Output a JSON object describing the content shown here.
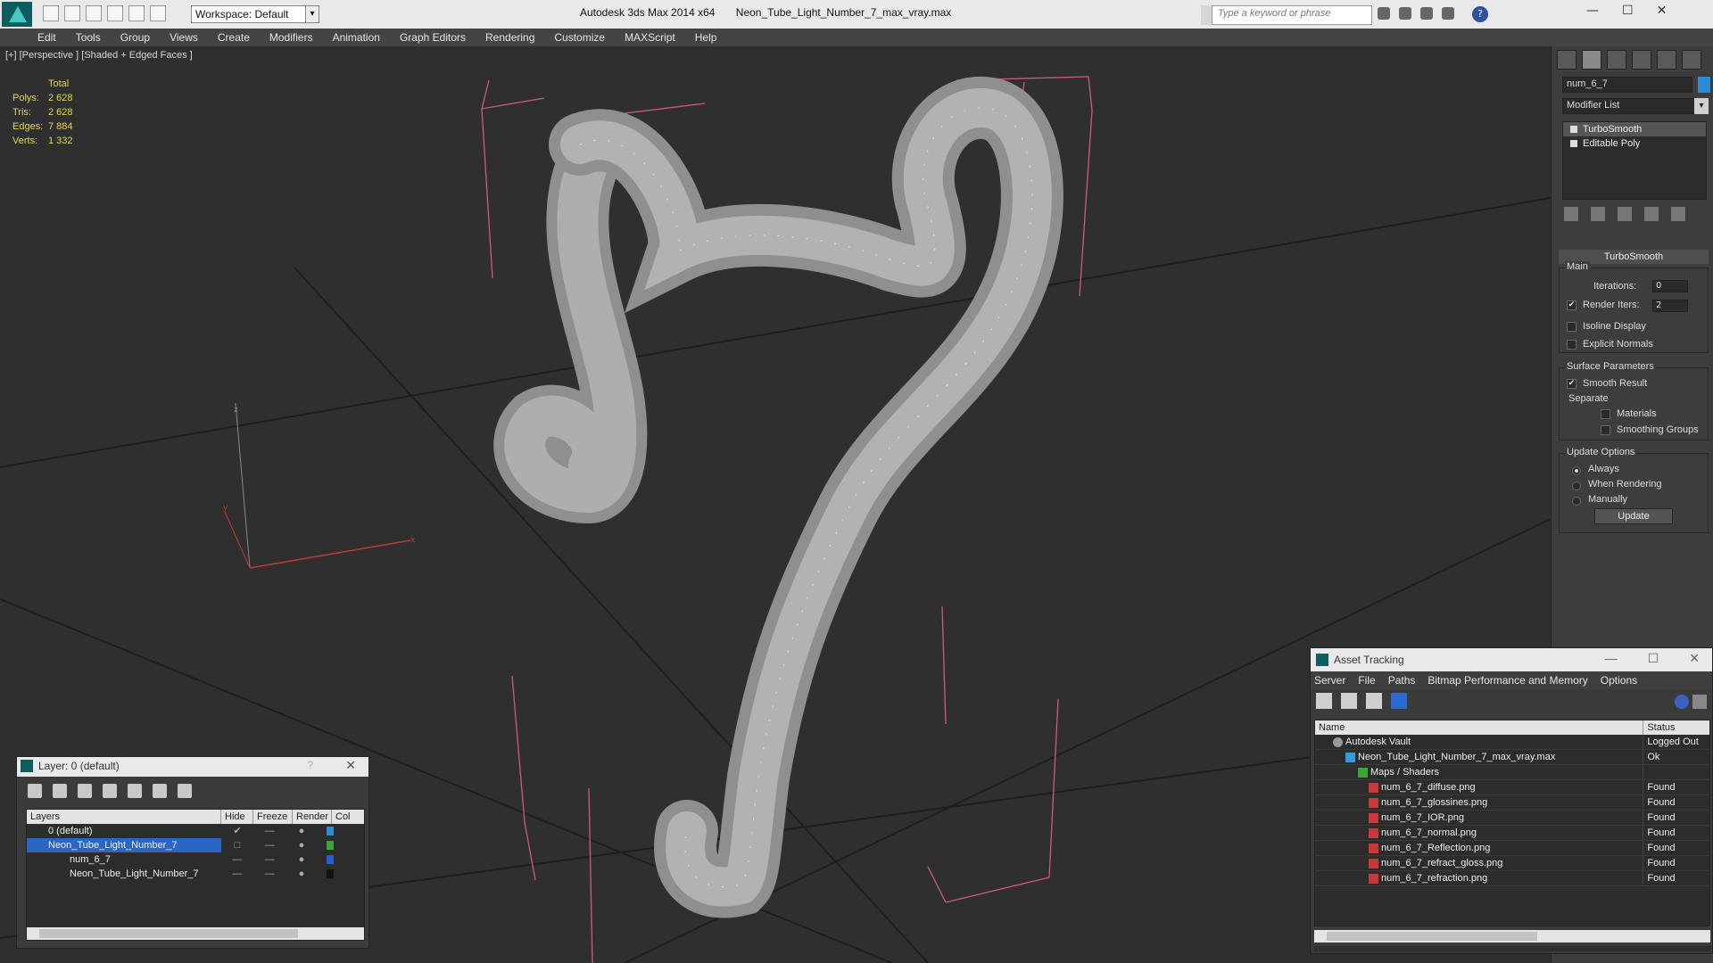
{
  "app": {
    "title": "Autodesk 3ds Max 2014 x64",
    "file": "Neon_Tube_Light_Number_7_max_vray.max",
    "workspace": "Workspace: Default",
    "search_placeholder": "Type a keyword or phrase"
  },
  "menu": [
    "Edit",
    "Tools",
    "Group",
    "Views",
    "Create",
    "Modifiers",
    "Animation",
    "Graph Editors",
    "Rendering",
    "Customize",
    "MAXScript",
    "Help"
  ],
  "viewport": {
    "label": "[+] [Perspective ] [Shaded + Edged Faces ]",
    "stats": {
      "header": "Total",
      "rows": [
        {
          "k": "Polys:",
          "v": "2 628"
        },
        {
          "k": "Tris:",
          "v": "2 628"
        },
        {
          "k": "Edges:",
          "v": "7 884"
        },
        {
          "k": "Verts:",
          "v": "1 332"
        }
      ]
    },
    "axes": {
      "x": "x",
      "y": "y",
      "z": "z"
    }
  },
  "command_panel": {
    "object_name": "num_6_7",
    "modifier_list": "Modifier List",
    "stack": [
      "TurboSmooth",
      "Editable Poly"
    ],
    "rollout": "TurboSmooth",
    "main_label": "Main",
    "iterations_label": "Iterations:",
    "iterations": "0",
    "render_iters_label": "Render Iters:",
    "render_iters": "2",
    "isoline": "Isoline Display",
    "explicit_normals": "Explicit Normals",
    "surface_params": "Surface Parameters",
    "smooth_result": "Smooth Result",
    "separate": "Separate",
    "materials": "Materials",
    "smoothing_groups": "Smoothing Groups",
    "update_options": "Update Options",
    "always": "Always",
    "when_rendering": "When Rendering",
    "manually": "Manually",
    "update_button": "Update"
  },
  "layer_window": {
    "title": "Layer: 0 (default)",
    "help": "?",
    "headers": [
      "Layers",
      "Hide",
      "Freeze",
      "Render",
      "Col"
    ],
    "rows": [
      {
        "name": "0 (default)",
        "color": "#2a8bd6"
      },
      {
        "name": "Neon_Tube_Light_Number_7",
        "color": "#3aa838"
      },
      {
        "name": "num_6_7",
        "color": "#2a5bd6"
      },
      {
        "name": "Neon_Tube_Light_Number_7",
        "color": "#111111"
      }
    ]
  },
  "asset_window": {
    "title": "Asset Tracking",
    "menu": [
      "Server",
      "File",
      "Paths",
      "Bitmap Performance and Memory",
      "Options"
    ],
    "col_name": "Name",
    "col_status": "Status",
    "rows": [
      {
        "name": "Autodesk Vault",
        "status": "Logged Out"
      },
      {
        "name": "Neon_Tube_Light_Number_7_max_vray.max",
        "status": "Ok"
      },
      {
        "name": "Maps / Shaders",
        "status": ""
      },
      {
        "name": "num_6_7_diffuse.png",
        "status": "Found"
      },
      {
        "name": "num_6_7_glossines.png",
        "status": "Found"
      },
      {
        "name": "num_6_7_IOR.png",
        "status": "Found"
      },
      {
        "name": "num_6_7_normal.png",
        "status": "Found"
      },
      {
        "name": "num_6_7_Reflection.png",
        "status": "Found"
      },
      {
        "name": "num_6_7_refract_gloss.png",
        "status": "Found"
      },
      {
        "name": "num_6_7_refraction.png",
        "status": "Found"
      }
    ]
  }
}
